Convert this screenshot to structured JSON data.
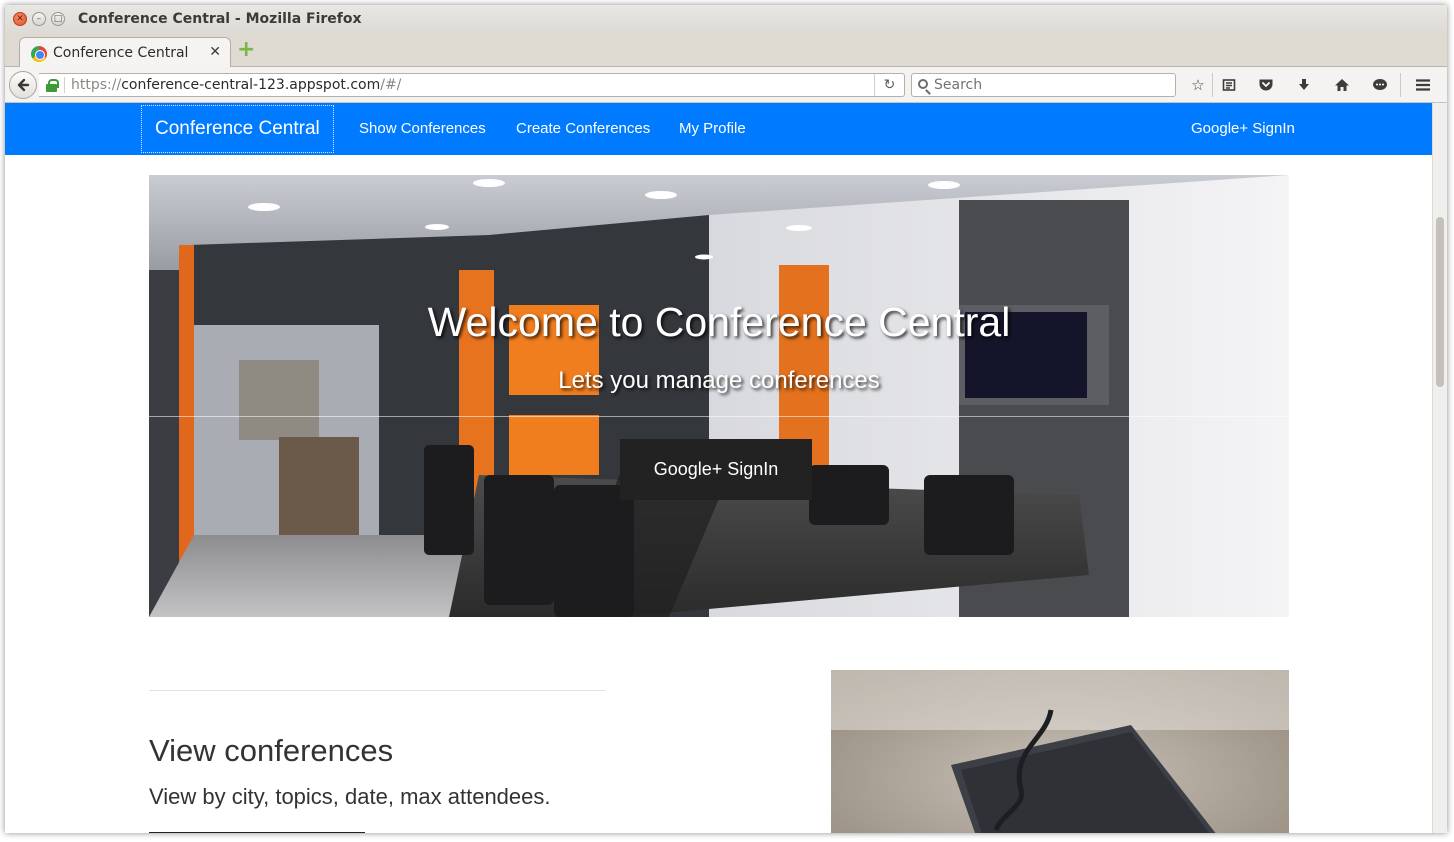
{
  "window": {
    "title": "Conference Central - Mozilla Firefox"
  },
  "tab": {
    "title": "Conference Central",
    "close_glyph": "✕",
    "new_tab_glyph": "+"
  },
  "urlbar": {
    "scheme": "https://",
    "host": "conference-central-123.appspot.com",
    "path": "/#/"
  },
  "search": {
    "placeholder": "Search"
  },
  "site_nav": {
    "brand": "Conference Central",
    "links": [
      "Show Conferences",
      "Create Conferences",
      "My Profile"
    ],
    "signin": "Google+ SignIn"
  },
  "hero": {
    "title": "Welcome to Conference Central",
    "subtitle": "Lets you manage conferences",
    "button": "Google+ SignIn"
  },
  "section": {
    "title": "View conferences",
    "subtitle": "View by city, topics, date, max attendees."
  },
  "icons": {
    "back": "back-arrow-icon",
    "lock": "lock-icon",
    "reload": "reload-icon",
    "search": "search-icon",
    "bookmark": "star-icon",
    "reading_list": "clipboard-icon",
    "pocket": "pocket-icon",
    "downloads": "download-arrow-icon",
    "home": "home-icon",
    "chat": "chat-bubble-icon",
    "menu": "hamburger-menu-icon"
  },
  "colors": {
    "nav_bg": "#007bff",
    "button_bg": "#222222",
    "lock_green": "#3d9a34"
  }
}
